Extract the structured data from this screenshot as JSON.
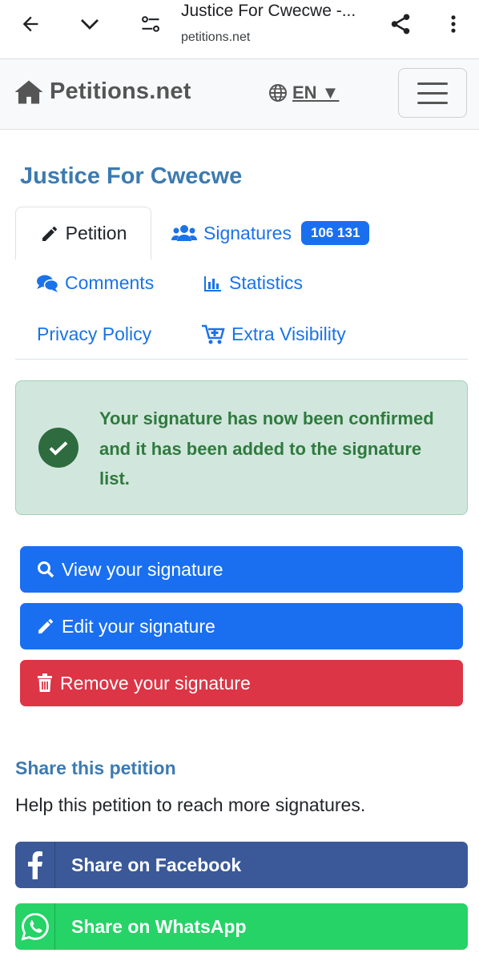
{
  "browser": {
    "tab_title": "Justice For Cwecwe -...",
    "host": "petitions.net",
    "icons": [
      "back-arrow-icon",
      "chevron-down-icon",
      "site-settings-icon",
      "share-icon",
      "more-vert-icon"
    ]
  },
  "navbar": {
    "brand": "Petitions.net",
    "language": "EN ▼",
    "icons": [
      "home-icon",
      "globe-icon",
      "hamburger-menu-icon"
    ]
  },
  "petition": {
    "title": "Justice For Cwecwe"
  },
  "tabs": {
    "petition": "Petition",
    "signatures": "Signatures",
    "signatures_count": "106 131",
    "comments": "Comments",
    "statistics": "Statistics",
    "privacy": "Privacy Policy",
    "extra": "Extra Visibility"
  },
  "alert": {
    "message": "Your signature has now been confirmed and it has been added to the signature list."
  },
  "actions": {
    "view": "View your signature",
    "edit": "Edit your signature",
    "remove": "Remove your signature"
  },
  "share": {
    "heading": "Share this petition",
    "subtitle": "Help this petition to reach more signatures.",
    "facebook": "Share on Facebook",
    "whatsapp": "Share on WhatsApp"
  },
  "colors": {
    "link_blue": "#1a73e8",
    "heading_blue": "#3d7ab0",
    "primary": "#1a6ff0",
    "danger": "#dc3545",
    "success_bg": "#d1e7dd",
    "success_text": "#2f7a3e",
    "facebook": "#3b5998",
    "whatsapp": "#25d366"
  }
}
